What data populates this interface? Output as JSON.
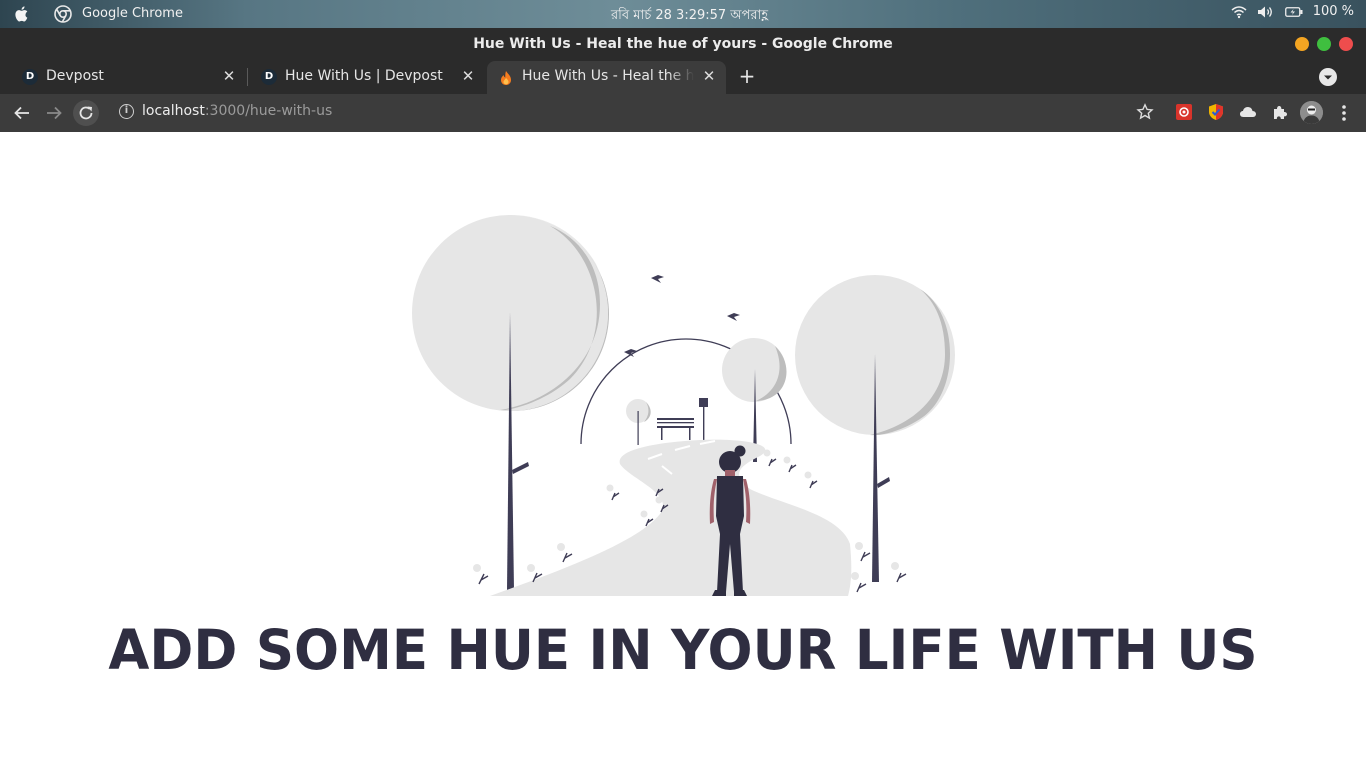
{
  "os_bar": {
    "app_name": "Google Chrome",
    "clock": "রবি মার্চ 28   3:29:57 অপরাহ্ণ",
    "battery": "100 %"
  },
  "window": {
    "title": "Hue With Us - Heal the hue of yours - Google Chrome"
  },
  "tabs": [
    {
      "label": "Devpost",
      "favicon": "D",
      "active": false
    },
    {
      "label": "Hue With Us | Devpost",
      "favicon": "D",
      "active": false
    },
    {
      "label": "Hue With Us - Heal the hue of yours",
      "favicon": "flame",
      "active": true
    }
  ],
  "toolbar": {
    "url_host": "localhost",
    "url_path": ":3000/hue-with-us"
  },
  "page": {
    "headline": "ADD SOME HUE IN YOUR LIFE WITH US"
  },
  "colors": {
    "dark": "#2f2e41",
    "light_gray": "#e6e6e6",
    "mid_gray": "#bdbdbd",
    "skin": "#a0616a"
  }
}
